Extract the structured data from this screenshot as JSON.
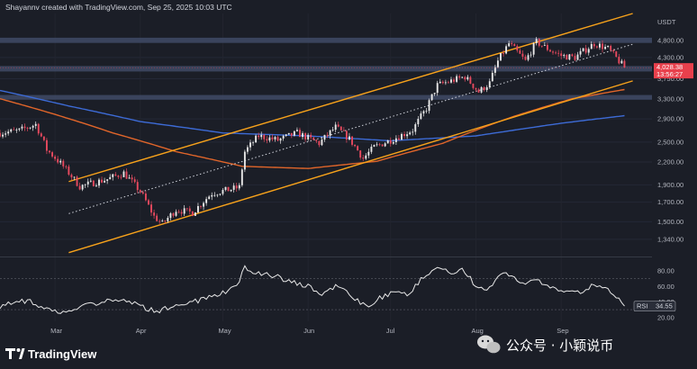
{
  "header": {
    "attribution": "Shayannv created with TradingView.com, Sep 25, 2025 10:03 UTC"
  },
  "branding": {
    "logo_text": "TradingView",
    "watermark_text": "公众号 · 小颖说币"
  },
  "colors": {
    "background": "#1b1e27",
    "candle_up": "#e8e8e8",
    "candle_down": "#e84a5f",
    "zone": "#3f4a66",
    "channel": "#f7a21b",
    "ma_blue": "#3d6bd6",
    "ma_orange": "#e0652a",
    "rsi_line": "#e8e8e8",
    "price_label": "#e8404c"
  },
  "chart_data": [
    {
      "type": "candlestick",
      "title": "",
      "quote_currency": "USDT",
      "y_scale": "log",
      "ylim": [
        1200,
        5700
      ],
      "yticks": [
        1340,
        1500,
        1700,
        1900,
        2200,
        2500,
        2900,
        3300,
        3750,
        4300,
        4800
      ],
      "ytick_labels": [
        "1,340.00",
        "1,500.00",
        "1,700.00",
        "1,900.00",
        "2,200.00",
        "2,500.00",
        "2,900.00",
        "3,300.00",
        "3,750.00",
        "4,300.00",
        "4,800.00"
      ],
      "x_start": "2025-02-09",
      "x_end": "2025-10-04",
      "xtick_labels": [
        "Mar",
        "Apr",
        "May",
        "Jun",
        "Jul",
        "Aug",
        "Sep"
      ],
      "xtick_dates": [
        "2025-03-01",
        "2025-04-01",
        "2025-05-01",
        "2025-06-01",
        "2025-07-01",
        "2025-08-01",
        "2025-09-01"
      ],
      "last_price": {
        "value": "4,028.38",
        "countdown": "13:56:27"
      },
      "close_anchors": [
        [
          "2025-02-09",
          2650
        ],
        [
          "2025-02-16",
          2690
        ],
        [
          "2025-02-22",
          2800
        ],
        [
          "2025-02-26",
          2380
        ],
        [
          "2025-03-03",
          2180
        ],
        [
          "2025-03-10",
          1880
        ],
        [
          "2025-03-20",
          1970
        ],
        [
          "2025-03-26",
          2050
        ],
        [
          "2025-04-01",
          1820
        ],
        [
          "2025-04-06",
          1550
        ],
        [
          "2025-04-09",
          1480
        ],
        [
          "2025-04-14",
          1620
        ],
        [
          "2025-04-20",
          1590
        ],
        [
          "2025-04-27",
          1800
        ],
        [
          "2025-05-03",
          1840
        ],
        [
          "2025-05-07",
          1870
        ],
        [
          "2025-05-09",
          2350
        ],
        [
          "2025-05-14",
          2600
        ],
        [
          "2025-05-21",
          2530
        ],
        [
          "2025-05-28",
          2650
        ],
        [
          "2025-06-05",
          2480
        ],
        [
          "2025-06-11",
          2750
        ],
        [
          "2025-06-16",
          2550
        ],
        [
          "2025-06-21",
          2250
        ],
        [
          "2025-06-25",
          2420
        ],
        [
          "2025-07-02",
          2550
        ],
        [
          "2025-07-09",
          2700
        ],
        [
          "2025-07-14",
          3100
        ],
        [
          "2025-07-18",
          3600
        ],
        [
          "2025-07-23",
          3700
        ],
        [
          "2025-07-28",
          3800
        ],
        [
          "2025-08-02",
          3450
        ],
        [
          "2025-08-06",
          3650
        ],
        [
          "2025-08-09",
          4200
        ],
        [
          "2025-08-13",
          4700
        ],
        [
          "2025-08-19",
          4200
        ],
        [
          "2025-08-23",
          4750
        ],
        [
          "2025-08-28",
          4500
        ],
        [
          "2025-09-01",
          4350
        ],
        [
          "2025-09-06",
          4300
        ],
        [
          "2025-09-13",
          4700
        ],
        [
          "2025-09-18",
          4550
        ],
        [
          "2025-09-22",
          4200
        ],
        [
          "2025-09-24",
          4028
        ]
      ],
      "support_resistance_zones": [
        {
          "low": 4720,
          "high": 4880
        },
        {
          "low": 3930,
          "high": 4070
        },
        {
          "low": 3280,
          "high": 3380
        }
      ],
      "channel": {
        "upper": [
          [
            "2025-03-06",
            1940
          ],
          [
            "2025-09-27",
            5700
          ]
        ],
        "middle": [
          [
            "2025-03-06",
            1580
          ],
          [
            "2025-09-27",
            4680
          ]
        ],
        "lower": [
          [
            "2025-03-06",
            1230
          ],
          [
            "2025-09-27",
            3700
          ]
        ]
      },
      "moving_averages": [
        {
          "color": "#3d6bd6",
          "anchors": [
            [
              "2025-02-09",
              3480
            ],
            [
              "2025-03-06",
              3150
            ],
            [
              "2025-04-01",
              2850
            ],
            [
              "2025-05-01",
              2650
            ],
            [
              "2025-06-01",
              2600
            ],
            [
              "2025-07-01",
              2520
            ],
            [
              "2025-08-01",
              2600
            ],
            [
              "2025-09-01",
              2820
            ],
            [
              "2025-09-24",
              2960
            ]
          ]
        },
        {
          "color": "#e0652a",
          "anchors": [
            [
              "2025-02-09",
              3300
            ],
            [
              "2025-02-28",
              3000
            ],
            [
              "2025-03-22",
              2650
            ],
            [
              "2025-04-14",
              2350
            ],
            [
              "2025-05-08",
              2140
            ],
            [
              "2025-06-01",
              2110
            ],
            [
              "2025-06-26",
              2210
            ],
            [
              "2025-07-20",
              2480
            ],
            [
              "2025-08-15",
              2950
            ],
            [
              "2025-09-05",
              3300
            ],
            [
              "2025-09-24",
              3500
            ]
          ]
        }
      ]
    },
    {
      "type": "line",
      "title": "",
      "series_label": "RSI",
      "last_value": "34.55",
      "ylim": [
        15,
        95
      ],
      "yticks": [
        20,
        40,
        60,
        80
      ],
      "ytick_labels": [
        "20.00",
        "40.00",
        "60.00",
        "80.00"
      ],
      "guides": [
        30,
        70
      ],
      "anchors": [
        [
          "2025-02-09",
          35
        ],
        [
          "2025-02-14",
          38
        ],
        [
          "2025-02-20",
          42
        ],
        [
          "2025-02-25",
          30
        ],
        [
          "2025-03-03",
          28
        ],
        [
          "2025-03-10",
          33
        ],
        [
          "2025-03-17",
          40
        ],
        [
          "2025-03-24",
          44
        ],
        [
          "2025-04-01",
          36
        ],
        [
          "2025-04-07",
          26
        ],
        [
          "2025-04-12",
          34
        ],
        [
          "2025-04-18",
          38
        ],
        [
          "2025-04-25",
          45
        ],
        [
          "2025-05-02",
          53
        ],
        [
          "2025-05-06",
          60
        ],
        [
          "2025-05-09",
          84
        ],
        [
          "2025-05-14",
          77
        ],
        [
          "2025-05-20",
          74
        ],
        [
          "2025-05-26",
          65
        ],
        [
          "2025-06-01",
          60
        ],
        [
          "2025-06-06",
          50
        ],
        [
          "2025-06-12",
          61
        ],
        [
          "2025-06-18",
          45
        ],
        [
          "2025-06-22",
          34
        ],
        [
          "2025-06-27",
          45
        ],
        [
          "2025-07-03",
          53
        ],
        [
          "2025-07-08",
          50
        ],
        [
          "2025-07-12",
          70
        ],
        [
          "2025-07-16",
          80
        ],
        [
          "2025-07-20",
          85
        ],
        [
          "2025-07-24",
          75
        ],
        [
          "2025-07-27",
          80
        ],
        [
          "2025-08-01",
          62
        ],
        [
          "2025-08-04",
          53
        ],
        [
          "2025-08-09",
          72
        ],
        [
          "2025-08-13",
          76
        ],
        [
          "2025-08-17",
          62
        ],
        [
          "2025-08-22",
          70
        ],
        [
          "2025-08-27",
          60
        ],
        [
          "2025-09-01",
          54
        ],
        [
          "2025-09-07",
          51
        ],
        [
          "2025-09-13",
          63
        ],
        [
          "2025-09-18",
          55
        ],
        [
          "2025-09-21",
          46
        ],
        [
          "2025-09-24",
          34.55
        ]
      ]
    }
  ]
}
